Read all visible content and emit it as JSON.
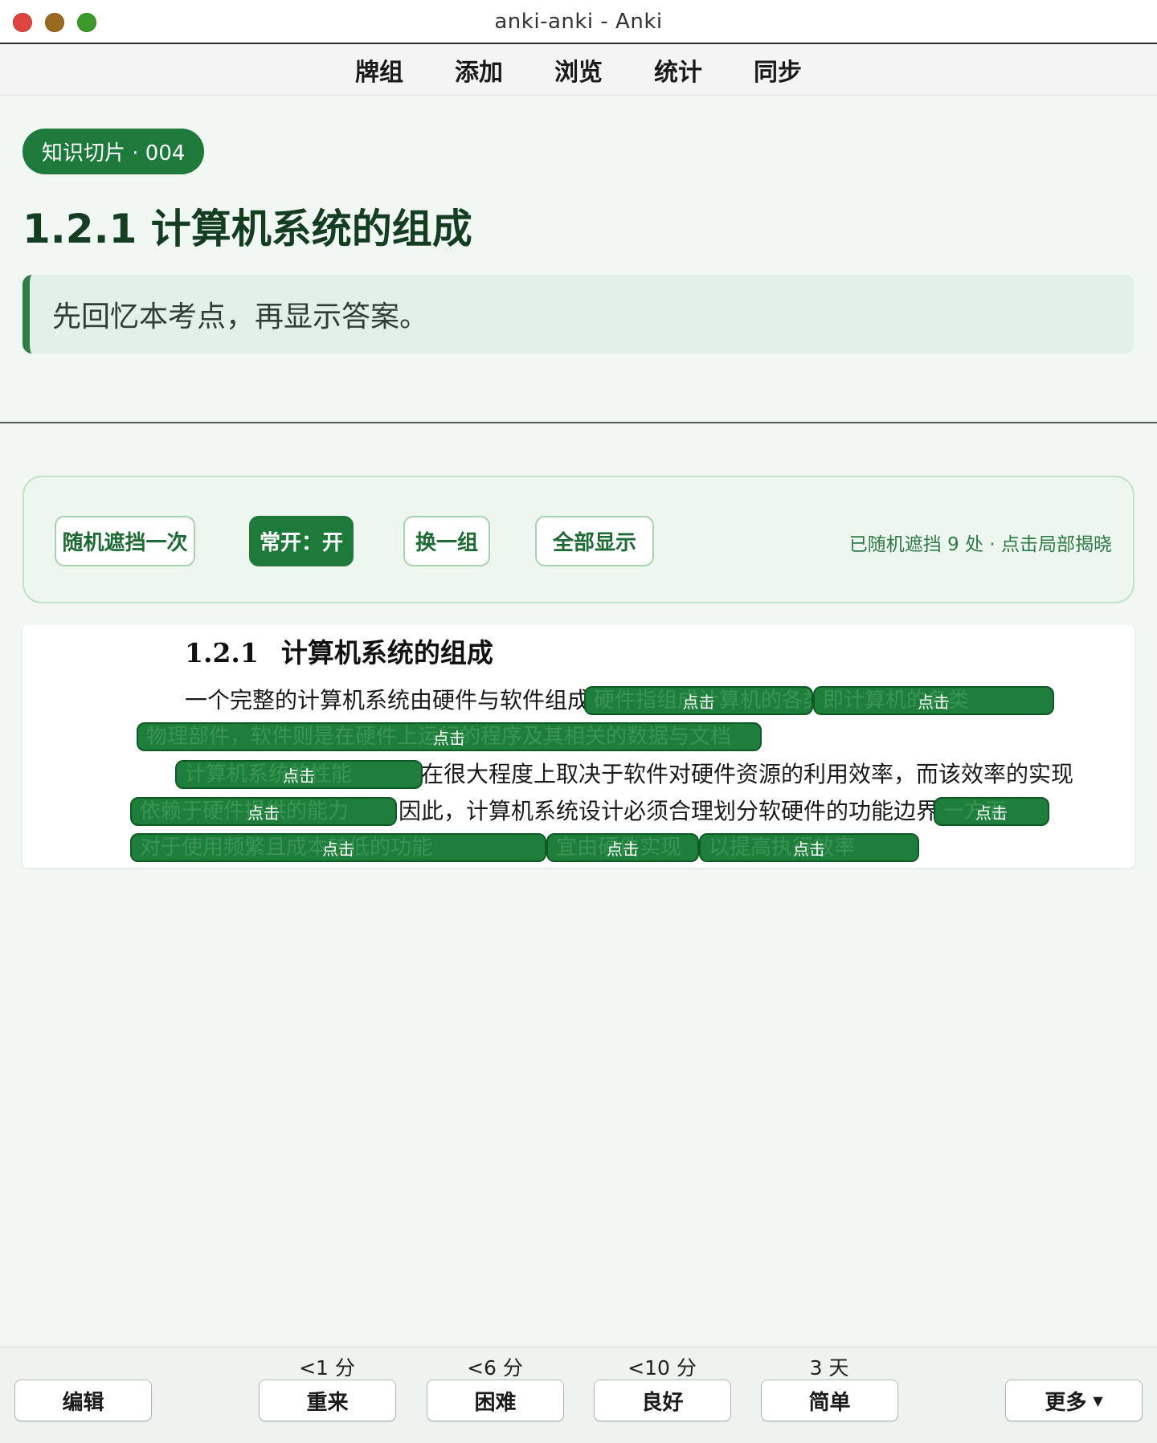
{
  "window": {
    "title": "anki-anki - Anki"
  },
  "nav": [
    "牌组",
    "添加",
    "浏览",
    "统计",
    "同步"
  ],
  "card": {
    "badge": "知识切片 · 004",
    "title": "1.2.1 计算机系统的组成",
    "hint": "先回忆本考点，再显示答案。"
  },
  "toolbar": {
    "random_mask": "随机遮挡一次",
    "always_on": "常开：开",
    "switch_group": "换一组",
    "show_all": "全部显示",
    "status": "已随机遮挡 9 处 · 点击局部揭晓"
  },
  "content": {
    "heading_num": "1.2.1",
    "heading_text": "计算机系统的组成",
    "line1_text": "一个完整的计算机系统由硬件与软件组成。",
    "line3_text": "在很大程度上取决于软件对硬件资源的利用效率，而该效率的实现",
    "line4_text": "因此，计算机系统设计必须合理划分软硬件的功能边界。",
    "mask_label": "点击",
    "mask_ghosts": [
      "硬件指组成计算机的各类",
      "即计算机的各类",
      "物理部件，软件则是在硬件上运行的程序及其相关的数据与文档",
      "计算机系统的性能",
      "依赖于硬件提供的能力",
      "一方面",
      "对于使用频繁且成本较低的功能",
      "宜由硬件实现",
      "以提高执行效率"
    ]
  },
  "answer_bar": {
    "edit": "编辑",
    "more": "更多",
    "buttons": [
      {
        "label": "重来",
        "due": "<1 分"
      },
      {
        "label": "困难",
        "due": "<6 分"
      },
      {
        "label": "良好",
        "due": "<10 分"
      },
      {
        "label": "简单",
        "due": "3 天"
      }
    ]
  }
}
